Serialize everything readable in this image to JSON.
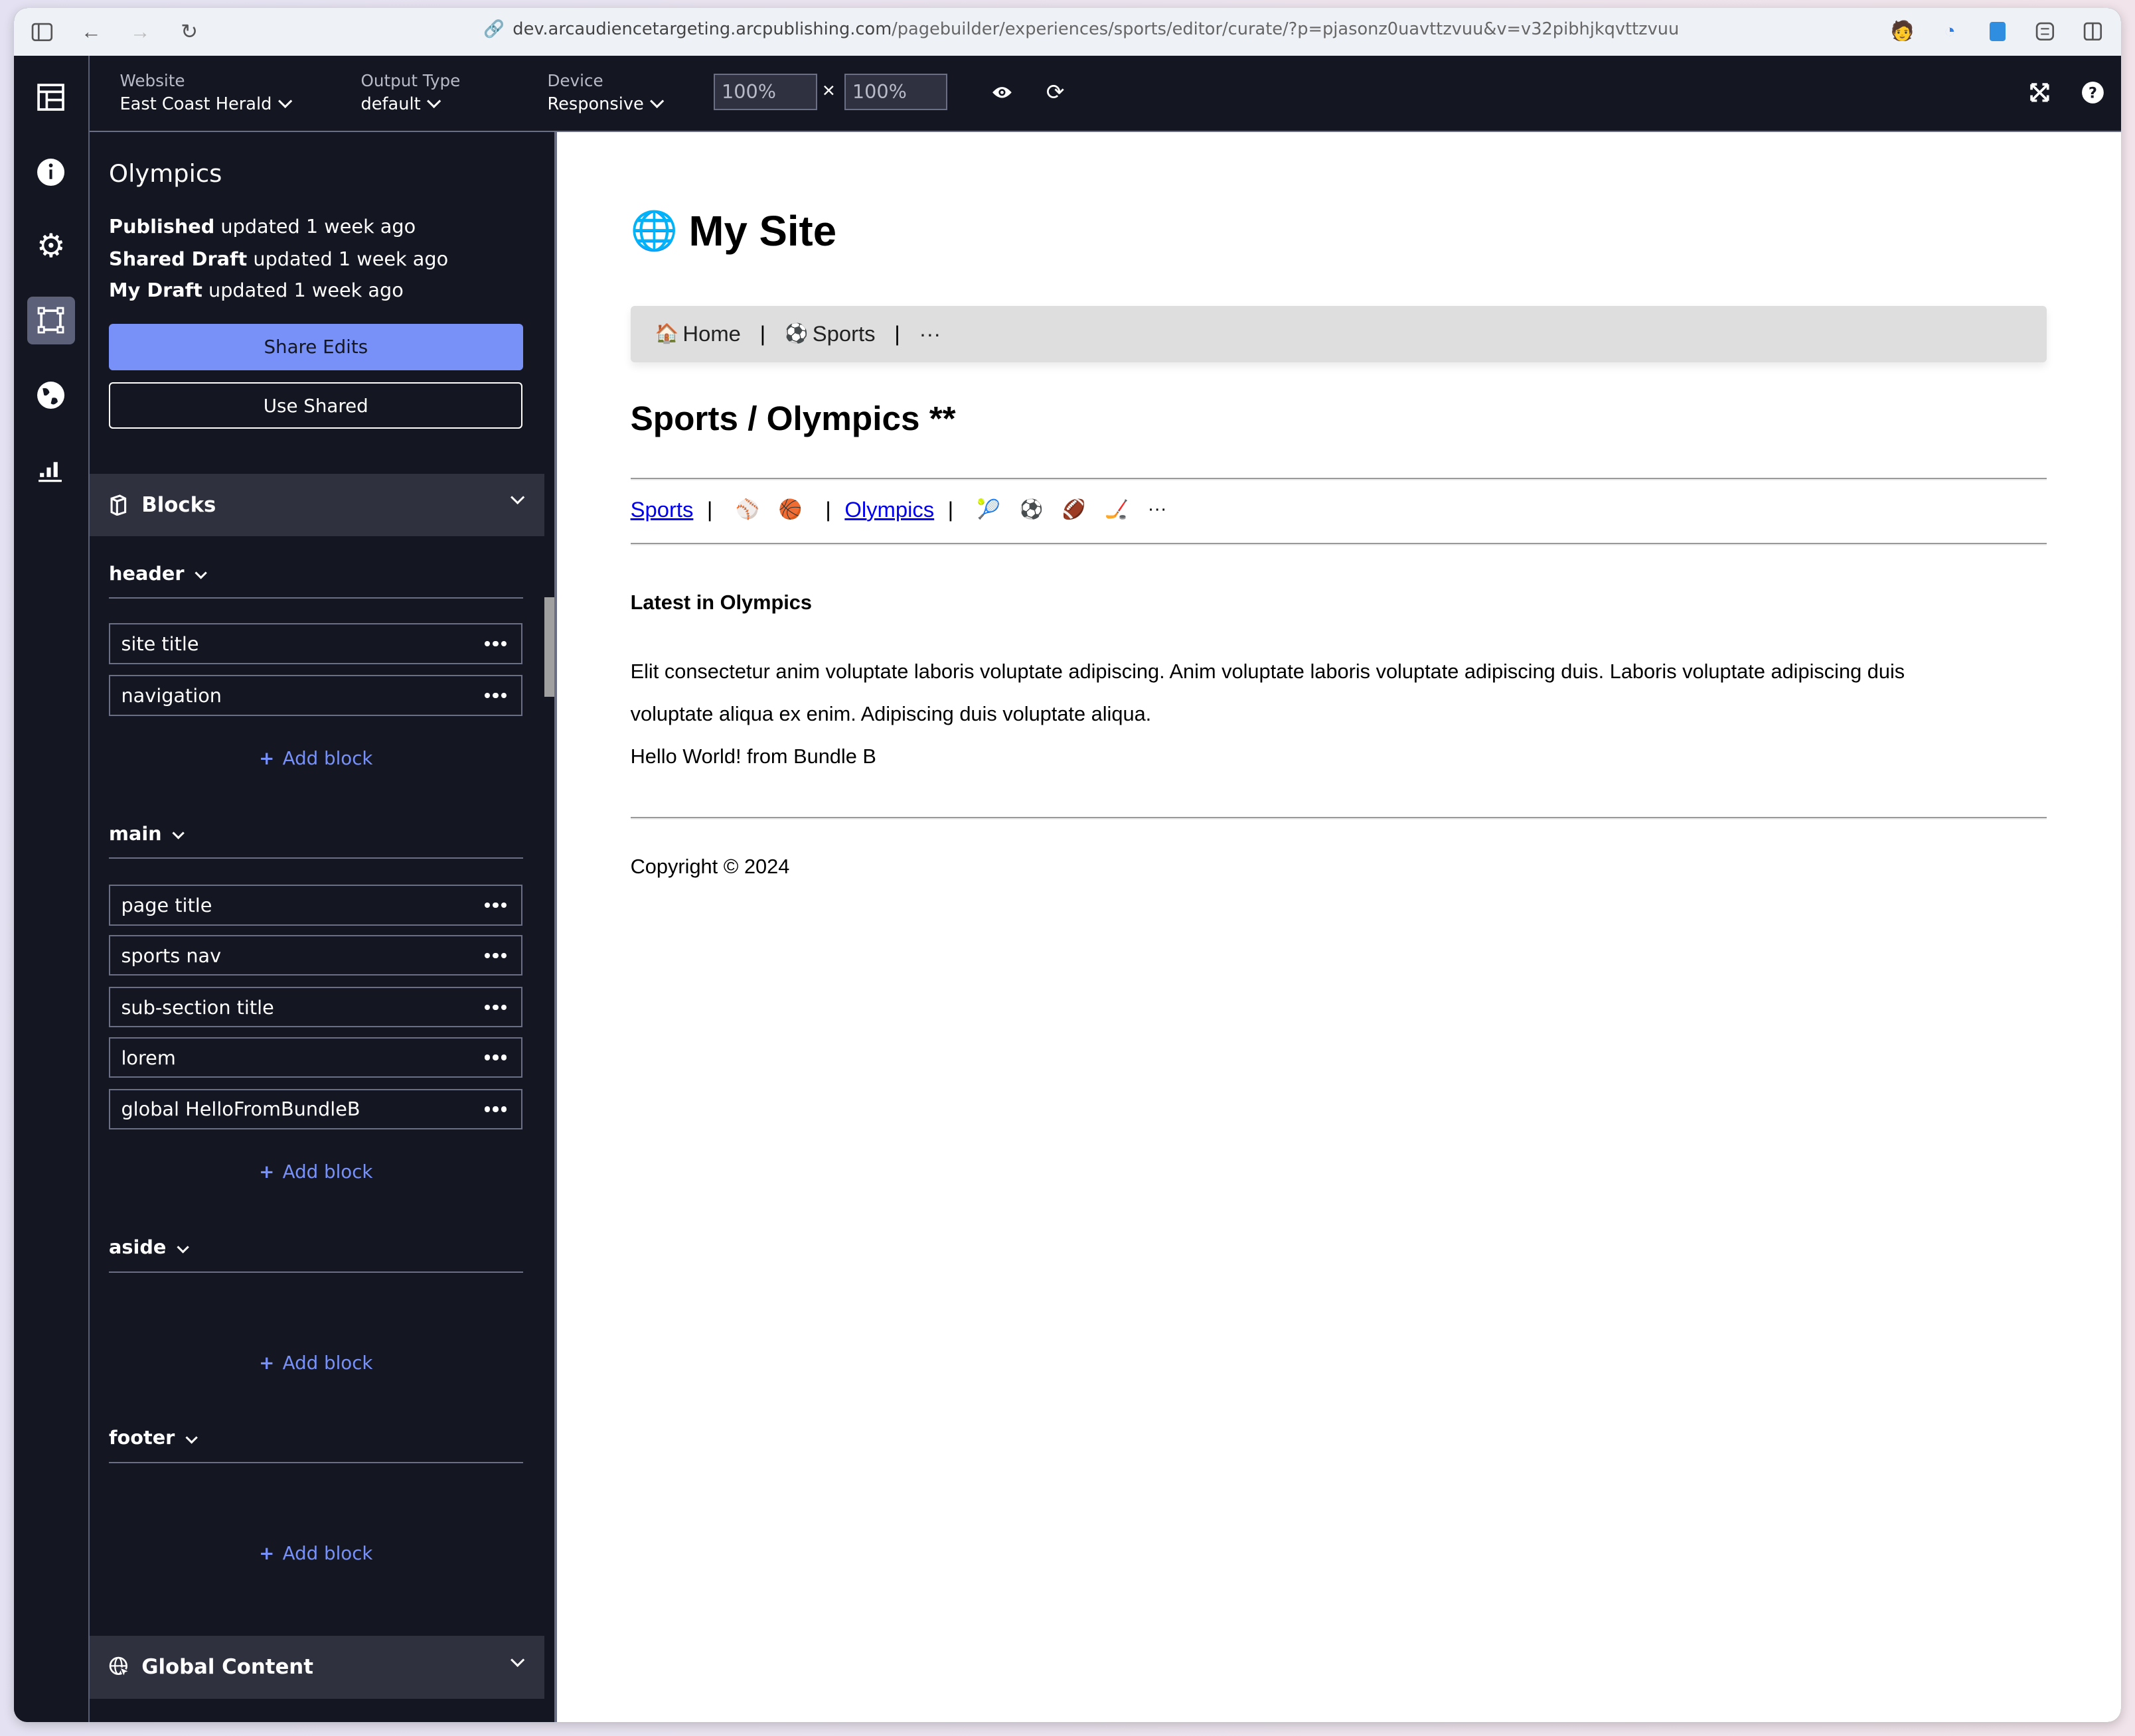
{
  "browser": {
    "url_host": "dev.arcaudiencetargeting.arcpublishing.com",
    "url_path": "/pagebuilder/experiences/sports/editor/curate/?p=pjasonz0uavttzvuu&v=v32pibhjkqvttzvuu"
  },
  "toolbar": {
    "website_label": "Website",
    "website_value": "East Coast Herald",
    "output_label": "Output Type",
    "output_value": "default",
    "device_label": "Device",
    "device_value": "Responsive",
    "width_value": "100%",
    "height_value": "100%",
    "times_symbol": "×"
  },
  "rail": {
    "items": [
      "layout-icon",
      "info-icon",
      "gear-icon",
      "curate-icon",
      "globe-icon",
      "analytics-icon"
    ],
    "active": "curate-icon"
  },
  "panel": {
    "title": "Olympics",
    "status": [
      {
        "label": "Published",
        "text": "updated 1 week ago"
      },
      {
        "label": "Shared Draft",
        "text": "updated 1 week ago"
      },
      {
        "label": "My Draft",
        "text": "updated 1 week ago"
      }
    ],
    "share_button": "Share Edits",
    "use_shared_button": "Use Shared",
    "blocks_title": "Blocks",
    "add_block_label": "Add block",
    "regions": [
      {
        "name": "header",
        "blocks": [
          "site title",
          "navigation"
        ]
      },
      {
        "name": "main",
        "blocks": [
          "page title",
          "sports nav",
          "sub-section title",
          "lorem",
          "global HelloFromBundleB"
        ]
      },
      {
        "name": "aside",
        "blocks": []
      },
      {
        "name": "footer",
        "blocks": []
      }
    ],
    "global_content_title": "Global Content"
  },
  "preview": {
    "site_emoji": "🌐",
    "site_title": "My Site",
    "nav": [
      {
        "emoji": "🏠",
        "label": "Home"
      },
      {
        "emoji": "⚽",
        "label": "Sports"
      },
      {
        "emoji": "",
        "label": "···"
      }
    ],
    "nav_separator": "|",
    "page_title": "Sports / Olympics **",
    "sports_nav": {
      "link1": "Sports",
      "group1": [
        "⚾",
        "🏀"
      ],
      "link2": "Olympics",
      "group2": [
        "🎾",
        "⚽",
        "🏈",
        "🏒"
      ],
      "more": "···"
    },
    "sub_title": "Latest in Olympics",
    "lorem": "Elit consectetur anim voluptate laboris voluptate adipiscing. Anim voluptate laboris voluptate adipiscing duis. Laboris voluptate adipiscing duis voluptate aliqua ex enim. Adipiscing duis voluptate aliqua.",
    "hello": "Hello World! from Bundle B",
    "copyright": "Copyright © 2024"
  },
  "colors": {
    "accent": "#7891f8",
    "app_bg": "#141722",
    "header_bg": "#2f313e",
    "link": "#0000ee"
  }
}
